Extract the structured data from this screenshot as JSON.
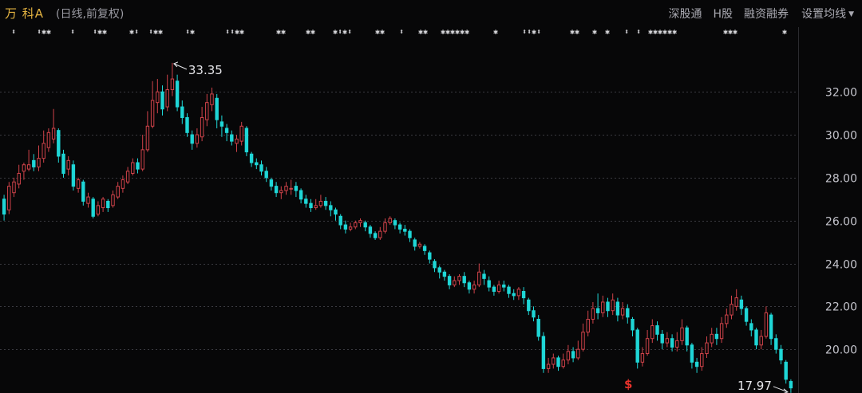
{
  "header": {
    "stock_name": "万 科A",
    "mode": "(日线,前复权)",
    "menu": [
      "深股通",
      "H股",
      "融资融券"
    ],
    "ma_setting": "设置均线"
  },
  "markers": [
    {
      "x": 14,
      "text": "⬍"
    },
    {
      "x": 46,
      "text": "⬍✱✱"
    },
    {
      "x": 88,
      "text": "⬍"
    },
    {
      "x": 116,
      "text": "⬍✱✱"
    },
    {
      "x": 162,
      "text": "✱⬍"
    },
    {
      "x": 186,
      "text": "⬍✱✱"
    },
    {
      "x": 232,
      "text": "⬍✱"
    },
    {
      "x": 282,
      "text": "⬍⬍✱✱"
    },
    {
      "x": 346,
      "text": "✱✱"
    },
    {
      "x": 383,
      "text": "✱✱"
    },
    {
      "x": 417,
      "text": "✱⬍✱⬍"
    },
    {
      "x": 470,
      "text": "✱✱"
    },
    {
      "x": 500,
      "text": "⬍"
    },
    {
      "x": 524,
      "text": "✱✱"
    },
    {
      "x": 552,
      "text": "✱✱✱✱✱✱"
    },
    {
      "x": 618,
      "text": "✱"
    },
    {
      "x": 654,
      "text": "⬍⬍✱⬍"
    },
    {
      "x": 714,
      "text": "✱✱"
    },
    {
      "x": 742,
      "text": "✱"
    },
    {
      "x": 758,
      "text": "✱"
    },
    {
      "x": 782,
      "text": "⬍"
    },
    {
      "x": 797,
      "text": "⬍"
    },
    {
      "x": 812,
      "text": "✱✱✱✱✱✱"
    },
    {
      "x": 906,
      "text": "✱✱✱"
    },
    {
      "x": 980,
      "text": "✱"
    }
  ],
  "signal_mark": "$",
  "chart_data": {
    "type": "candlestick",
    "title": "",
    "ylim": [
      18.0,
      34.2
    ],
    "yticks": [
      "20.00",
      "22.00",
      "24.00",
      "26.00",
      "28.00",
      "30.00",
      "32.00"
    ],
    "annotations": {
      "high": {
        "value": "33.35",
        "price": 33.35
      },
      "low": {
        "value": "17.97",
        "price": 17.97
      }
    },
    "colors": {
      "up": "#d0434a",
      "down": "#1fd6d6",
      "grid": "#3a3a40",
      "text": "#c4c4cc"
    },
    "candles": [
      [
        27.0,
        26.3,
        27.2,
        26.0
      ],
      [
        26.5,
        27.6,
        27.8,
        26.3
      ],
      [
        27.3,
        27.8,
        28.0,
        27.1
      ],
      [
        27.7,
        28.2,
        28.6,
        27.5
      ],
      [
        28.3,
        28.6,
        28.7,
        27.9
      ],
      [
        28.4,
        28.6,
        29.3,
        28.3
      ],
      [
        28.8,
        28.5,
        29.1,
        28.3
      ],
      [
        28.5,
        28.9,
        29.5,
        28.3
      ],
      [
        28.9,
        29.6,
        30.2,
        28.7
      ],
      [
        29.4,
        30.1,
        30.3,
        29.2
      ],
      [
        29.8,
        30.3,
        31.2,
        29.6
      ],
      [
        30.2,
        29.0,
        30.3,
        28.7
      ],
      [
        29.1,
        28.2,
        29.3,
        28.0
      ],
      [
        28.4,
        28.8,
        29.0,
        28.1
      ],
      [
        28.6,
        27.6,
        28.8,
        27.4
      ],
      [
        27.5,
        27.9,
        28.0,
        27.3
      ],
      [
        27.8,
        26.9,
        27.9,
        26.7
      ],
      [
        26.8,
        27.1,
        27.3,
        26.6
      ],
      [
        27.0,
        26.2,
        27.1,
        26.1
      ],
      [
        26.3,
        26.7,
        26.9,
        26.2
      ],
      [
        26.6,
        27.0,
        27.1,
        26.4
      ],
      [
        26.9,
        26.6,
        27.0,
        26.4
      ],
      [
        26.7,
        27.2,
        27.4,
        26.6
      ],
      [
        27.1,
        27.6,
        27.8,
        27.0
      ],
      [
        27.5,
        27.9,
        28.1,
        27.3
      ],
      [
        27.8,
        28.3,
        28.5,
        27.7
      ],
      [
        28.2,
        28.7,
        28.9,
        28.1
      ],
      [
        28.7,
        28.4,
        28.9,
        28.2
      ],
      [
        28.4,
        29.3,
        30.0,
        28.3
      ],
      [
        29.3,
        30.4,
        31.1,
        29.2
      ],
      [
        30.4,
        31.6,
        32.5,
        30.3
      ],
      [
        31.5,
        32.0,
        32.6,
        31.0
      ],
      [
        32.0,
        31.2,
        32.3,
        30.9
      ],
      [
        31.3,
        32.1,
        32.8,
        31.1
      ],
      [
        32.1,
        32.6,
        33.35,
        31.8
      ],
      [
        32.5,
        31.3,
        32.8,
        31.1
      ],
      [
        31.3,
        30.8,
        31.6,
        30.5
      ],
      [
        30.8,
        30.1,
        31.0,
        29.9
      ],
      [
        30.0,
        29.6,
        30.2,
        29.3
      ],
      [
        29.6,
        30.0,
        30.3,
        29.4
      ],
      [
        29.9,
        30.8,
        31.3,
        29.7
      ],
      [
        30.7,
        31.5,
        31.9,
        30.4
      ],
      [
        31.4,
        31.9,
        32.2,
        31.1
      ],
      [
        31.7,
        30.7,
        31.9,
        30.3
      ],
      [
        30.6,
        30.4,
        30.9,
        29.9
      ],
      [
        30.3,
        30.1,
        30.5,
        29.7
      ],
      [
        30.0,
        29.7,
        30.2,
        29.5
      ],
      [
        29.6,
        29.8,
        30.0,
        29.2
      ],
      [
        29.7,
        30.4,
        30.6,
        29.5
      ],
      [
        30.3,
        29.2,
        30.4,
        29.0
      ],
      [
        29.1,
        28.7,
        29.2,
        28.5
      ],
      [
        28.7,
        28.6,
        28.9,
        28.4
      ],
      [
        28.6,
        28.3,
        28.8,
        28.1
      ],
      [
        28.3,
        28.0,
        28.5,
        27.8
      ],
      [
        27.9,
        27.6,
        28.0,
        27.4
      ],
      [
        27.6,
        27.3,
        27.8,
        27.1
      ],
      [
        27.3,
        27.4,
        27.6,
        27.0
      ],
      [
        27.4,
        27.6,
        27.8,
        27.2
      ],
      [
        27.5,
        27.5,
        27.9,
        27.2
      ],
      [
        27.6,
        27.4,
        27.8,
        27.1
      ],
      [
        27.4,
        27.0,
        27.5,
        26.8
      ],
      [
        27.0,
        26.8,
        27.2,
        26.6
      ],
      [
        26.8,
        26.6,
        27.0,
        26.4
      ],
      [
        26.6,
        26.7,
        27.0,
        26.5
      ],
      [
        26.7,
        26.9,
        27.2,
        26.6
      ],
      [
        26.9,
        26.7,
        27.1,
        26.5
      ],
      [
        26.7,
        26.5,
        26.9,
        26.2
      ],
      [
        26.5,
        26.3,
        26.6,
        26.0
      ],
      [
        26.2,
        25.8,
        26.3,
        25.6
      ],
      [
        25.8,
        25.6,
        26.0,
        25.4
      ],
      [
        25.6,
        25.7,
        25.9,
        25.5
      ],
      [
        25.7,
        25.9,
        26.0,
        25.6
      ],
      [
        25.9,
        26.0,
        26.1,
        25.7
      ],
      [
        25.9,
        25.7,
        26.0,
        25.5
      ],
      [
        25.7,
        25.4,
        25.8,
        25.2
      ],
      [
        25.4,
        25.2,
        25.5,
        25.1
      ],
      [
        25.2,
        25.5,
        25.7,
        25.1
      ],
      [
        25.5,
        25.9,
        26.1,
        25.4
      ],
      [
        25.9,
        26.1,
        26.2,
        25.8
      ],
      [
        26.0,
        25.8,
        26.1,
        25.6
      ],
      [
        25.8,
        25.6,
        25.9,
        25.4
      ],
      [
        25.6,
        25.5,
        25.8,
        25.3
      ],
      [
        25.5,
        25.2,
        25.6,
        25.0
      ],
      [
        25.1,
        24.8,
        25.2,
        24.6
      ],
      [
        24.8,
        24.9,
        25.0,
        24.7
      ],
      [
        24.8,
        24.6,
        24.9,
        24.4
      ],
      [
        24.5,
        24.2,
        24.6,
        24.0
      ],
      [
        24.1,
        23.8,
        24.2,
        23.6
      ],
      [
        23.8,
        23.6,
        23.9,
        23.3
      ],
      [
        23.6,
        23.4,
        23.7,
        23.2
      ],
      [
        23.4,
        23.0,
        23.5,
        22.8
      ],
      [
        23.0,
        23.2,
        23.4,
        22.9
      ],
      [
        23.2,
        23.4,
        23.5,
        23.0
      ],
      [
        23.4,
        23.1,
        23.6,
        22.9
      ],
      [
        23.1,
        22.8,
        23.2,
        22.6
      ],
      [
        22.8,
        23.0,
        23.2,
        22.6
      ],
      [
        23.0,
        23.6,
        24.0,
        22.9
      ],
      [
        23.5,
        23.3,
        23.7,
        23.0
      ],
      [
        23.2,
        22.9,
        23.4,
        22.7
      ],
      [
        22.9,
        22.7,
        23.0,
        22.5
      ],
      [
        22.7,
        23.0,
        23.2,
        22.6
      ],
      [
        23.0,
        22.9,
        23.2,
        22.7
      ],
      [
        22.9,
        22.6,
        23.0,
        22.4
      ],
      [
        22.6,
        22.5,
        22.8,
        22.3
      ],
      [
        22.5,
        22.8,
        22.9,
        22.3
      ],
      [
        22.7,
        22.4,
        22.9,
        22.1
      ],
      [
        22.3,
        21.8,
        22.4,
        21.6
      ],
      [
        21.8,
        21.5,
        22.0,
        21.3
      ],
      [
        21.4,
        20.6,
        21.6,
        20.4
      ],
      [
        20.6,
        19.1,
        20.8,
        18.9
      ],
      [
        19.1,
        19.3,
        19.6,
        18.9
      ],
      [
        19.3,
        19.6,
        19.8,
        19.1
      ],
      [
        19.6,
        19.2,
        19.7,
        19.0
      ],
      [
        19.2,
        19.5,
        19.8,
        19.1
      ],
      [
        19.5,
        19.9,
        20.2,
        19.3
      ],
      [
        19.9,
        19.6,
        20.1,
        19.4
      ],
      [
        19.6,
        20.0,
        20.4,
        19.5
      ],
      [
        20.0,
        20.8,
        21.2,
        19.9
      ],
      [
        20.8,
        21.4,
        21.8,
        20.6
      ],
      [
        21.4,
        21.9,
        22.2,
        21.2
      ],
      [
        21.9,
        21.7,
        22.6,
        21.4
      ],
      [
        21.7,
        22.2,
        22.5,
        21.5
      ],
      [
        22.2,
        21.8,
        22.4,
        21.5
      ],
      [
        21.8,
        22.3,
        22.6,
        21.6
      ],
      [
        22.2,
        21.6,
        22.4,
        21.3
      ],
      [
        21.6,
        21.9,
        22.2,
        21.4
      ],
      [
        21.9,
        21.5,
        22.1,
        21.2
      ],
      [
        21.4,
        20.9,
        21.5,
        20.6
      ],
      [
        20.9,
        19.4,
        21.0,
        19.1
      ],
      [
        19.4,
        19.8,
        20.1,
        19.2
      ],
      [
        19.8,
        20.5,
        20.9,
        19.7
      ],
      [
        20.5,
        21.1,
        21.4,
        20.3
      ],
      [
        21.1,
        20.7,
        21.3,
        20.4
      ],
      [
        20.7,
        20.3,
        20.9,
        20.0
      ],
      [
        20.3,
        20.5,
        20.8,
        20.1
      ],
      [
        20.5,
        20.1,
        20.7,
        19.9
      ],
      [
        20.1,
        20.4,
        20.8,
        19.9
      ],
      [
        20.4,
        21.0,
        21.4,
        20.2
      ],
      [
        21.0,
        20.2,
        21.1,
        19.9
      ],
      [
        20.2,
        19.4,
        20.3,
        19.1
      ],
      [
        19.4,
        19.2,
        19.6,
        18.9
      ],
      [
        19.2,
        19.8,
        20.1,
        19.0
      ],
      [
        19.8,
        20.3,
        20.6,
        19.6
      ],
      [
        20.3,
        20.7,
        21.0,
        20.1
      ],
      [
        20.7,
        20.5,
        21.0,
        20.2
      ],
      [
        20.5,
        21.2,
        21.5,
        20.3
      ],
      [
        21.2,
        21.6,
        21.9,
        21.0
      ],
      [
        21.6,
        22.1,
        22.5,
        21.4
      ],
      [
        22.0,
        22.4,
        22.8,
        21.8
      ],
      [
        22.3,
        21.9,
        22.5,
        21.6
      ],
      [
        21.9,
        21.3,
        22.0,
        21.1
      ],
      [
        21.2,
        20.9,
        21.4,
        20.6
      ],
      [
        20.9,
        20.2,
        21.0,
        20.0
      ],
      [
        20.2,
        20.6,
        20.9,
        20.0
      ],
      [
        20.6,
        21.7,
        22.0,
        20.5
      ],
      [
        21.6,
        20.5,
        21.7,
        20.2
      ],
      [
        20.5,
        20.0,
        20.7,
        19.8
      ],
      [
        20.0,
        19.5,
        20.2,
        19.3
      ],
      [
        19.4,
        18.6,
        19.5,
        18.4
      ],
      [
        18.5,
        18.2,
        18.6,
        17.97
      ]
    ]
  }
}
